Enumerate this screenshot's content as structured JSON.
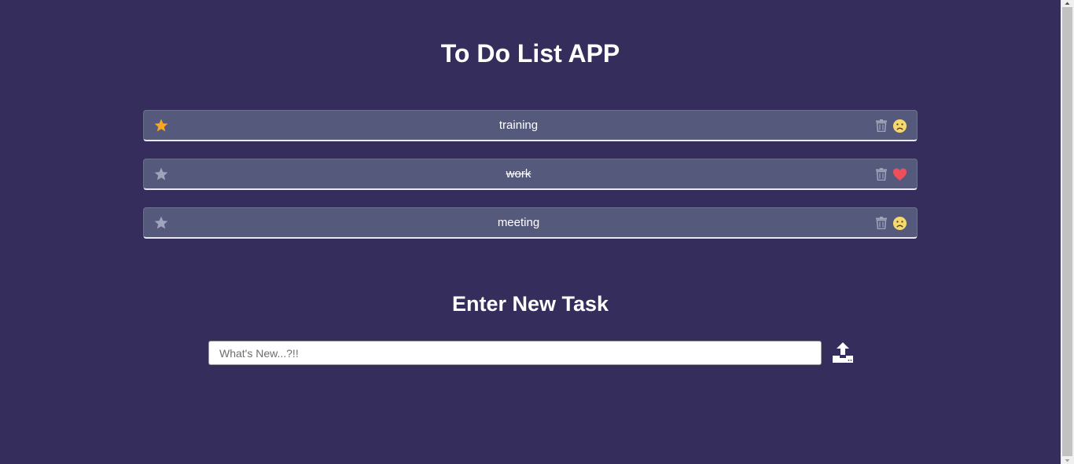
{
  "app": {
    "title": "To Do List APP"
  },
  "tasks": [
    {
      "text": "training",
      "starred": true,
      "completed": false,
      "mood": "sad-face-icon"
    },
    {
      "text": "work",
      "starred": false,
      "completed": true,
      "mood": "heart-icon"
    },
    {
      "text": "meeting",
      "starred": false,
      "completed": false,
      "mood": "sad-face-icon"
    }
  ],
  "new_task": {
    "heading": "Enter New Task",
    "placeholder": "What's New...?!!",
    "value": ""
  },
  "icons": {
    "star": "star-icon",
    "delete": "trash-icon",
    "submit": "upload-icon"
  },
  "colors": {
    "background": "#352e5c",
    "task_row": "#555a7c",
    "star_active": "#f5a623",
    "star_inactive": "#a1a3bb",
    "heart": "#f04e58",
    "face": "#f7d96b"
  }
}
